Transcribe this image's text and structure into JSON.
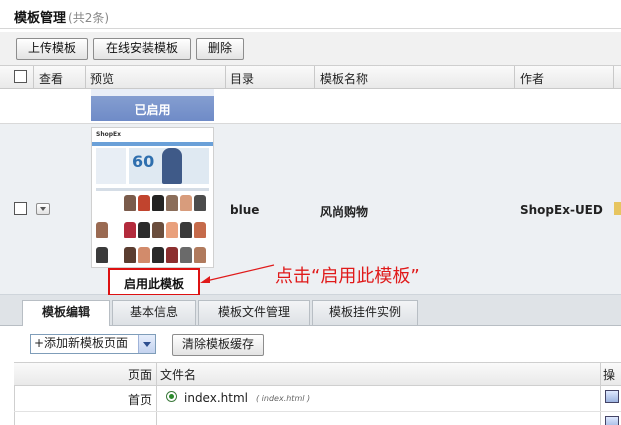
{
  "header": {
    "title": "模板管理",
    "count": "(共2条)"
  },
  "toolbar": {
    "upload": "上传模板",
    "install_online": "在线安装模板",
    "delete": "删除"
  },
  "columns": {
    "view": "查看",
    "preview": "预览",
    "directory": "目录",
    "name": "模板名称",
    "author": "作者"
  },
  "rows": [
    {
      "status": "已启用"
    },
    {
      "directory": "blue",
      "name": "风尚购物",
      "author": "ShopEx-UED",
      "enable_button": "启用此模板"
    }
  ],
  "annotation": "点击“启用此模板”",
  "thumbnail": {
    "logo": "ShopEx",
    "promo": "60"
  },
  "tabs": [
    "模板编辑",
    "基本信息",
    "模板文件管理",
    "模板挂件实例"
  ],
  "editor": {
    "add_page": "+添加新模板页面",
    "clear_cache": "清除模板缓存"
  },
  "file_table": {
    "headers": {
      "page": "页面",
      "filename": "文件名",
      "action": "操"
    },
    "rows": [
      {
        "page": "首页",
        "file": "index.html",
        "file_note": "( index.html )"
      }
    ]
  },
  "colors": {
    "accent_blue": "#6f8bc7",
    "annotation_red": "#e01a1a"
  }
}
